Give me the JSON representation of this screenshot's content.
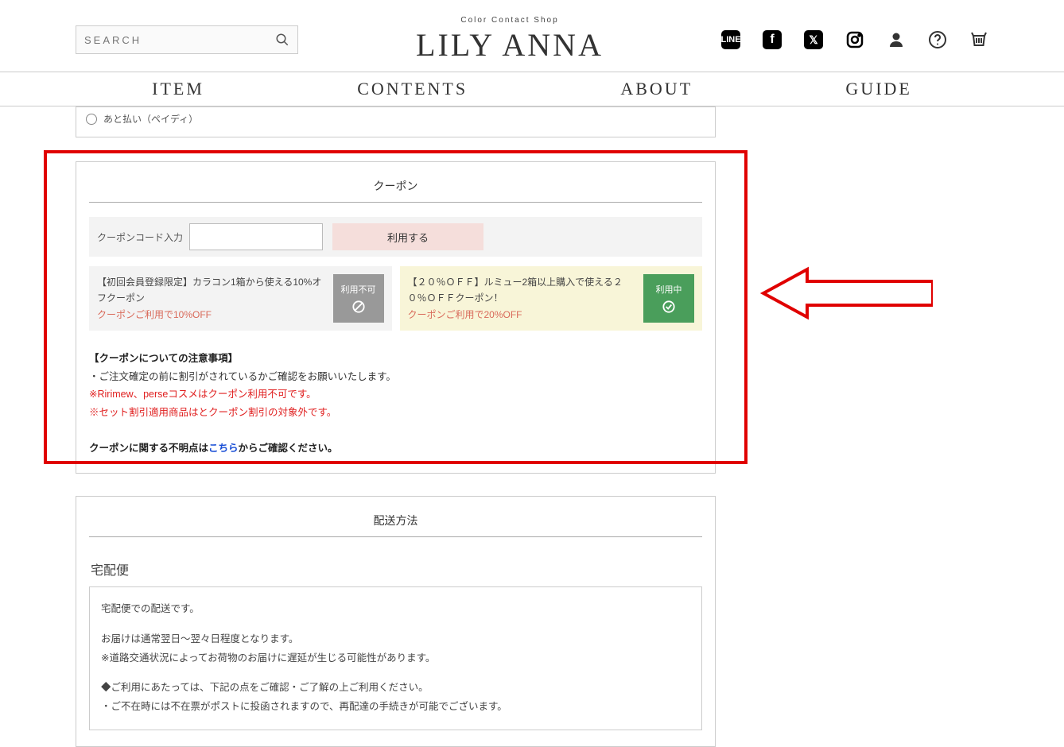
{
  "header": {
    "search_placeholder": "SEARCH",
    "tagline": "Color Contact Shop",
    "logo": "LILY ANNA"
  },
  "nav": {
    "items": [
      "ITEM",
      "CONTENTS",
      "ABOUT",
      "GUIDE"
    ]
  },
  "payment": {
    "option": "あと払い（ペイディ）"
  },
  "coupon": {
    "title": "クーポン",
    "input_label": "クーポンコード入力",
    "use_button": "利用する",
    "cards": [
      {
        "line1": "【初回会員登録限定】カラコン1箱から使える10%オフクーポン",
        "discount": "クーポンご利用で10%OFF",
        "badge": "利用不可"
      },
      {
        "line1": "【２０％ＯＦＦ】ルミュー2箱以上購入で使える２０％ＯＦＦクーポン！",
        "discount": "クーポンご利用で20%OFF",
        "badge": "利用中"
      }
    ],
    "notes": {
      "heading": "【クーポンについての注意事項】",
      "line1": "・ご注文確定の前に割引がされているかご確認をお願いいたします。",
      "line2": "※Ririmew、perseコスメはクーポン利用不可です。",
      "line3": "※セット割引適用商品はとクーポン割引の対象外です。",
      "line4a": "クーポンに関する不明点は",
      "line4link": "こちら",
      "line4b": "からご確認ください。"
    }
  },
  "shipping": {
    "title": "配送方法",
    "subtitle": "宅配便",
    "body1": "宅配便での配送です。",
    "body2a": "お届けは通常翌日〜翌々日程度となります。",
    "body2b": "※道路交通状況によってお荷物のお届けに遅延が生じる可能性があります。",
    "body3a": "◆ご利用にあたっては、下記の点をご確認・ご了解の上ご利用ください。",
    "body3b": "・ご不在時には不在票がポストに投函されますので、再配達の手続きが可能でございます。"
  }
}
